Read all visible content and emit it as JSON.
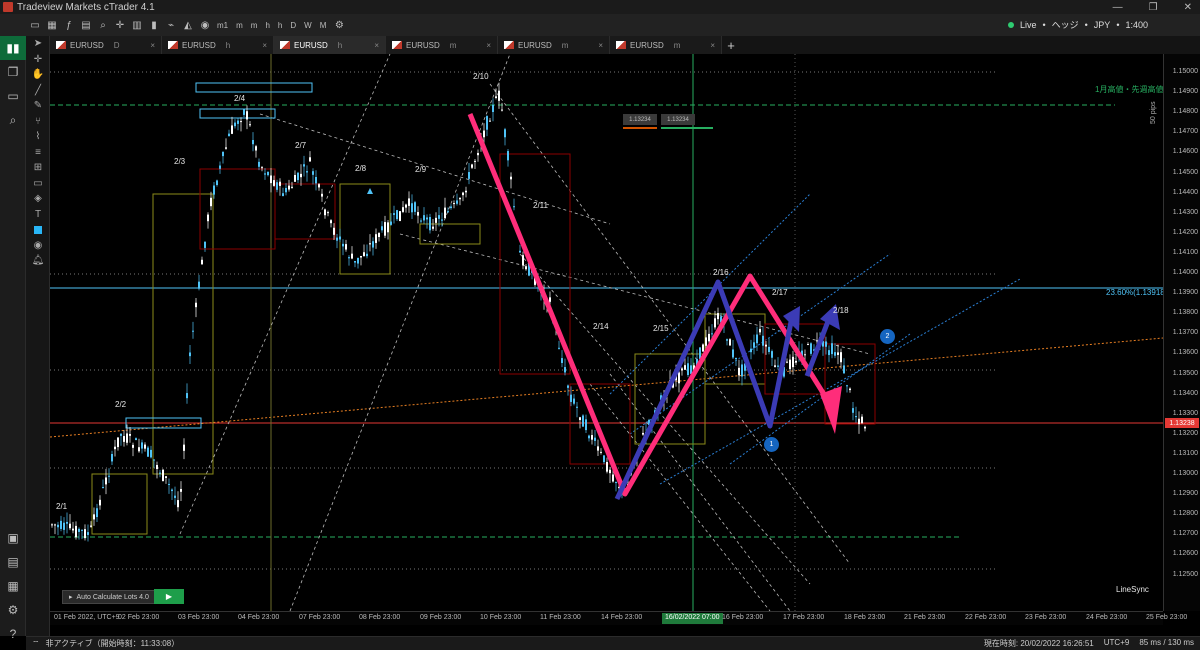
{
  "window": {
    "title": "Tradeview Markets cTrader 4.1",
    "controls": [
      "—",
      "❐",
      "✕"
    ]
  },
  "toolbar": {
    "timeframes": [
      "m1",
      "m",
      "m",
      "h",
      "h",
      "D",
      "W",
      "M"
    ],
    "live_label": "Live",
    "account_label": "ヘッジ",
    "currency": "JPY",
    "leverage": "1:400"
  },
  "tabs": [
    {
      "symbol": "EURUSD",
      "timeframe": "D",
      "active": false
    },
    {
      "symbol": "EURUSD",
      "timeframe": "h",
      "active": false
    },
    {
      "symbol": "EURUSD",
      "timeframe": "h",
      "active": true
    },
    {
      "symbol": "EURUSD",
      "timeframe": "m",
      "active": false
    },
    {
      "symbol": "EURUSD",
      "timeframe": "m",
      "active": false
    },
    {
      "symbol": "EURUSD",
      "timeframe": "m",
      "active": false
    }
  ],
  "chart": {
    "bid": "1.13234",
    "ask": "1.13234",
    "current_price": "1.13238",
    "fib_label": "23.60%(1.13918)",
    "monthly_label": "1月高値・先週高値",
    "pips_label": "50 pips",
    "linesync": "LineSync",
    "auto_lot": "Auto Calculate Lots 4.0",
    "date_labels": [
      "2/1",
      "2/2",
      "2/3",
      "2/4",
      "2/7",
      "2/8",
      "2/9",
      "2/10",
      "2/11",
      "2/14",
      "2/15",
      "2/16",
      "2/17",
      "2/18"
    ],
    "markers": [
      "1",
      "2"
    ]
  },
  "price_axis": [
    "1.15000",
    "1.14900",
    "1.14800",
    "1.14700",
    "1.14600",
    "1.14500",
    "1.14400",
    "1.14300",
    "1.14200",
    "1.14100",
    "1.14000",
    "1.13900",
    "1.13800",
    "1.13700",
    "1.13600",
    "1.13500",
    "1.13400",
    "1.13300",
    "1.13200",
    "1.13100",
    "1.13000",
    "1.12900",
    "1.12800",
    "1.12700",
    "1.12600",
    "1.12500"
  ],
  "time_axis": [
    "01 Feb 2022, UTC+9",
    "02 Feb 23:00",
    "03 Feb 23:00",
    "04 Feb 23:00",
    "07 Feb 23:00",
    "08 Feb 23:00",
    "09 Feb 23:00",
    "10 Feb 23:00",
    "11 Feb 23:00",
    "14 Feb 23:00",
    "16/02/2022 07:00",
    "16 Feb 23:00",
    "17 Feb 23:00",
    "18 Feb 23:00",
    "21 Feb 23:00",
    "22 Feb 23:00",
    "23 Feb 23:00",
    "24 Feb 23:00",
    "25 Feb 23:00"
  ],
  "time_cursor": "05:00",
  "status": {
    "left_state": "非アクティブ（開始時刻：11:33:08）",
    "current_time_label": "現在時刻",
    "current_time": "20/02/2022 16:26:51",
    "timezone": "UTC+9",
    "latency": "85 ms / 130 ms"
  },
  "colors": {
    "up_candle": "#4fc3f7",
    "down_candle": "#ffffff",
    "pink_arrow": "#ff2d7a",
    "blue_arrow": "#3b3bb5",
    "green_line": "#27ae60",
    "fib_line": "#4fc3f7",
    "price_badge": "#e53935"
  }
}
